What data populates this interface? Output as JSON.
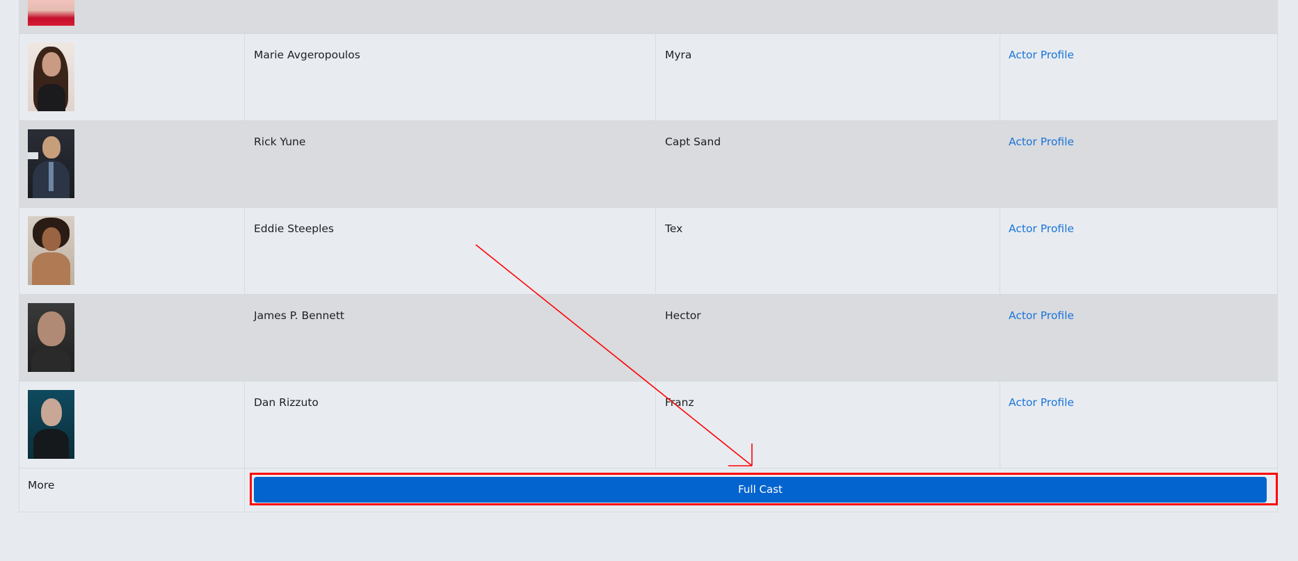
{
  "cast": {
    "rows": [
      {
        "actor": "Marie Avgeropoulos",
        "character": "Myra",
        "link": "Actor Profile"
      },
      {
        "actor": "Rick Yune",
        "character": "Capt Sand",
        "link": "Actor Profile"
      },
      {
        "actor": "Eddie Steeples",
        "character": "Tex",
        "link": "Actor Profile"
      },
      {
        "actor": "James P. Bennett",
        "character": "Hector",
        "link": "Actor Profile"
      },
      {
        "actor": "Dan Rizzuto",
        "character": "Franz",
        "link": "Actor Profile"
      }
    ],
    "more_label": "More",
    "full_cast_button": "Full Cast"
  },
  "colors": {
    "page_bg": "#e7ebef",
    "row_light": "#e8ecf0",
    "row_dark": "#d9dbde",
    "link": "#1a73d9",
    "button": "#0464cf",
    "annotation": "#ff0000"
  }
}
